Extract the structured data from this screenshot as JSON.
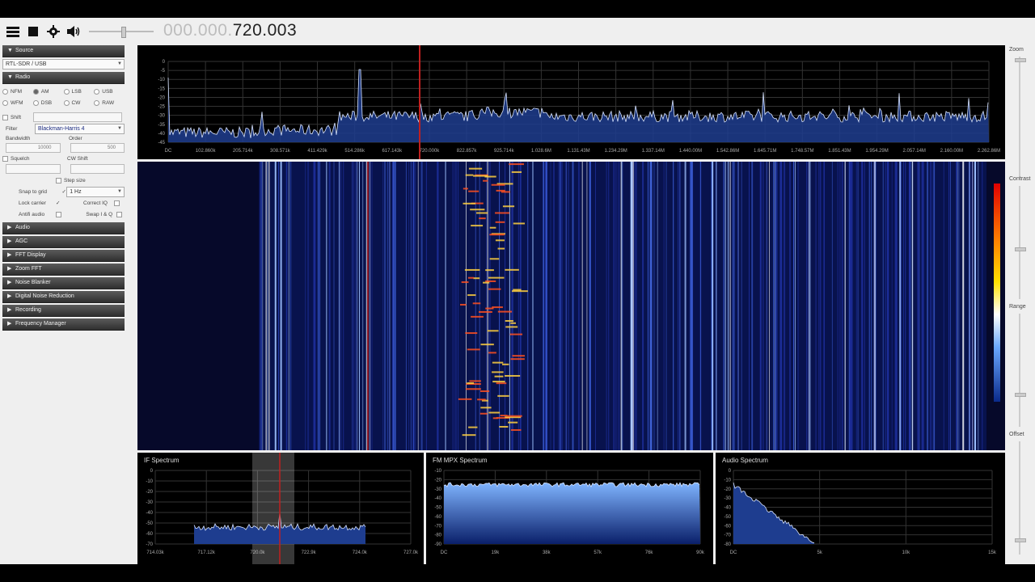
{
  "toolbar": {
    "icons": [
      "menu-icon",
      "stop-icon",
      "gear-icon",
      "speaker-icon"
    ],
    "freq_dim": "000.000.",
    "freq_bright": "720.003"
  },
  "panel": {
    "source": {
      "header": "Source",
      "device": "RTL-SDR / USB"
    },
    "radio": {
      "header": "Radio",
      "modes_row1": [
        "NFM",
        "AM",
        "LSB",
        "USB"
      ],
      "modes_row2": [
        "WFM",
        "DSB",
        "CW",
        "RAW"
      ],
      "selected_mode": "AM",
      "shift_label": "Shift",
      "filter_label": "Filter",
      "filter_value": "Blackman-Harris 4",
      "bandwidth_label": "Bandwidth",
      "bandwidth_value": "10000",
      "order_label": "Order",
      "order_value": "500",
      "squelch_label": "Squelch",
      "cw_shift_label": "CW Shift",
      "step_size_label": "Step size",
      "snap_label": "Snap to grid",
      "snap_value": "1 Hz",
      "lock_carrier_label": "Lock carrier",
      "correct_iq_label": "Correct IQ",
      "amp_aud_label": "Antifi audio",
      "swap_iq_label": "Swap I & Q"
    },
    "collapsed_sections": [
      "Audio",
      "AGC",
      "FFT Display",
      "Zoom FFT",
      "Noise Blanker",
      "Digital Noise Reduction",
      "Recording",
      "Frequency Manager"
    ]
  },
  "spectrum": {
    "y_labels": [
      "0",
      "-5",
      "-10",
      "-15",
      "-20",
      "-25",
      "-30",
      "-35",
      "-40",
      "-45"
    ],
    "x_labels": [
      "DC",
      "102.860k",
      "205.714k",
      "308.571k",
      "411.429k",
      "514.286k",
      "617.143k",
      "720.000k",
      "822.857k",
      "925.714k",
      "1.028.6M",
      "1.131.43M",
      "1.234.29M",
      "1.337.14M",
      "1.440.00M",
      "1.542.86M",
      "1.645.71M",
      "1.748.57M",
      "1.851.43M",
      "1.954.29M",
      "2.057.14M",
      "2.160.00M",
      "2.262.86M"
    ]
  },
  "if_spectrum": {
    "title": "IF Spectrum",
    "y_labels": [
      "0",
      "-10",
      "-20",
      "-30",
      "-40",
      "-50",
      "-60",
      "-70"
    ],
    "x_labels": [
      "714.03k",
      "717.12k",
      "720.0k",
      "722.9k",
      "724.0k",
      "727.0k"
    ]
  },
  "mpx_spectrum": {
    "title": "FM MPX Spectrum",
    "y_labels": [
      "-10",
      "-20",
      "-30",
      "-40",
      "-50",
      "-60",
      "-70",
      "-80",
      "-90"
    ],
    "x_labels": [
      "DC",
      "19k",
      "38k",
      "57k",
      "76k",
      "90k"
    ]
  },
  "audio_spectrum": {
    "title": "Audio Spectrum",
    "y_labels": [
      "0",
      "-10",
      "-20",
      "-30",
      "-40",
      "-50",
      "-60",
      "-70",
      "-80"
    ],
    "x_labels": [
      "DC",
      "5k",
      "10k",
      "15k"
    ]
  },
  "right_bar": {
    "zoom": "Zoom",
    "contrast": "Contrast",
    "range": "Range",
    "offset": "Offset"
  },
  "colors": {
    "accent_red": "#c02020",
    "spectrum_fill": "#1e3d8f",
    "trace": "#d8e4ff"
  }
}
